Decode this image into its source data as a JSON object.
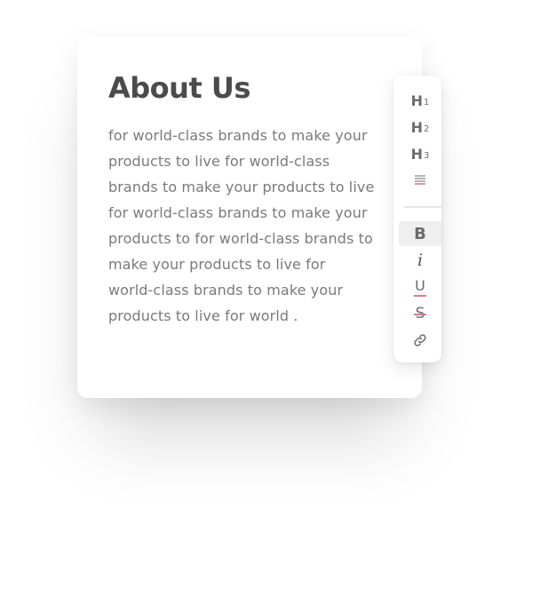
{
  "card": {
    "title": "About Us",
    "body": "for world-class brands to make your products to live for world-class brands to make your products to live for world-class brands to make your products to for world-class brands to make your products to live for world-class brands to make your products to live for world ."
  },
  "toolbar": {
    "heading1": {
      "main": "H",
      "sub": "1"
    },
    "heading2": {
      "main": "H",
      "sub": "2"
    },
    "heading3": {
      "main": "H",
      "sub": "3"
    },
    "bold_label": "B",
    "italic_label": "i",
    "underline_label": "U",
    "strike_label": "S",
    "active_tool": "bold",
    "icons": [
      "align-justify-icon",
      "link-icon"
    ]
  },
  "colors": {
    "title": "#4b4b4b",
    "body_text": "#7a7a7a",
    "icon": "#6b6b6b",
    "accent": "#e07a7a",
    "active_bg": "#efefef"
  }
}
